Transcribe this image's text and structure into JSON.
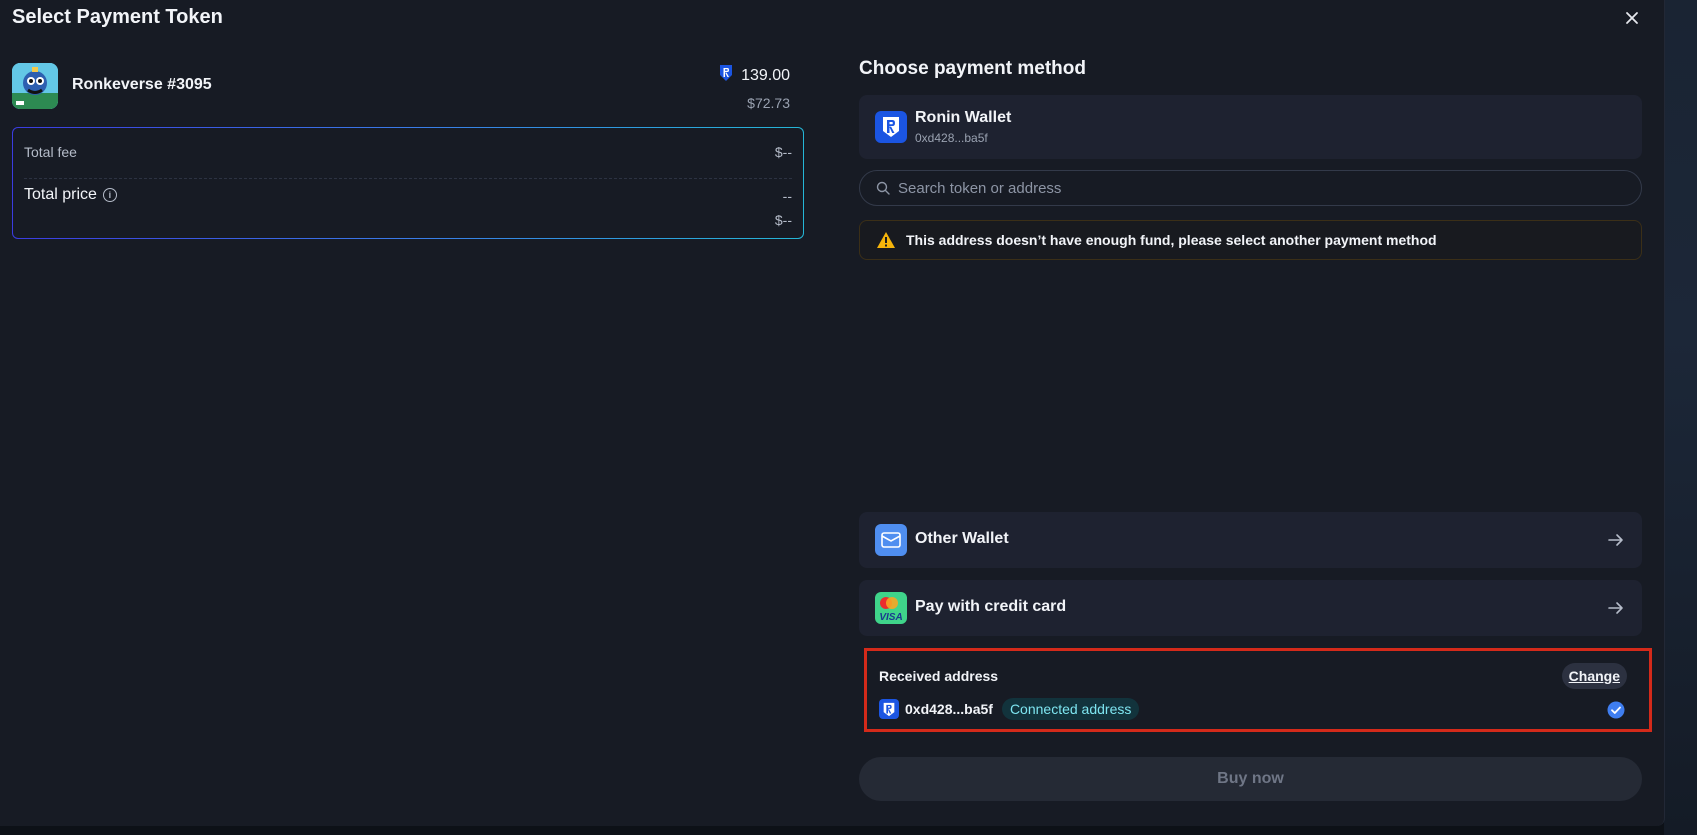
{
  "modal": {
    "title": "Select Payment Token",
    "close_icon": "close-icon"
  },
  "item": {
    "name": "Ronkeverse #3095",
    "price_token": "139.00",
    "price_usd": "$72.73",
    "token_icon": "ronin-shield-icon"
  },
  "fees": {
    "total_fee_label": "Total fee",
    "total_fee_value": "$--",
    "total_price_label": "Total price",
    "total_price_value": "--",
    "total_price_usd": "$--"
  },
  "payment": {
    "heading": "Choose payment method",
    "wallet": {
      "name": "Ronin Wallet",
      "address": "0xd428...ba5f"
    },
    "search_placeholder": "Search token or address",
    "warning": "This address doesn’t have enough fund, please select another payment method",
    "other_wallet_label": "Other Wallet",
    "credit_card_label": "Pay with credit card"
  },
  "received": {
    "label": "Received address",
    "change_label": "Change",
    "address": "0xd428...ba5f",
    "badge": "Connected address"
  },
  "buy_label": "Buy now",
  "colors": {
    "background": "#171b24",
    "card": "#1e2230",
    "ronin_blue": "#1b55e2",
    "highlight_border": "#d42a1a",
    "badge_text": "#7ee5f0"
  }
}
